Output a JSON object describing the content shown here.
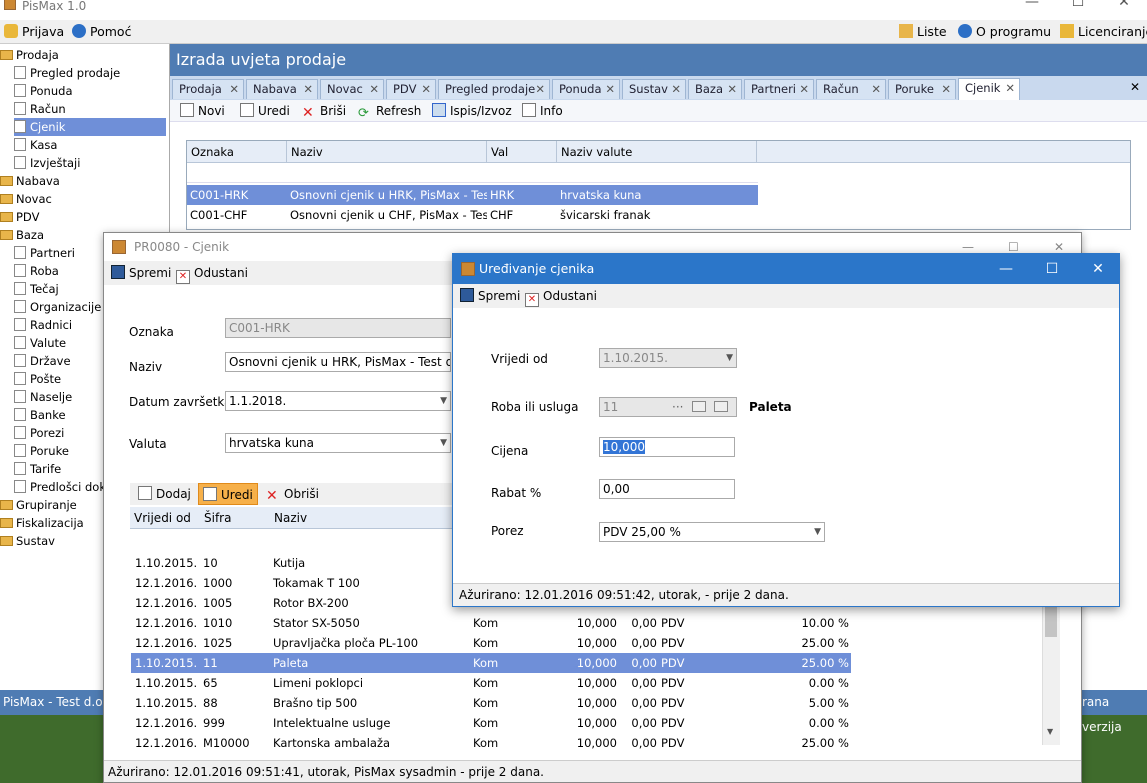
{
  "app": {
    "title": "PisMax 1.0"
  },
  "menu": {
    "left": [
      "Prijava",
      "Pomoć"
    ],
    "right": [
      "Liste",
      "O programu",
      "Licenciranje"
    ]
  },
  "sidebar": {
    "items": [
      {
        "label": "Prodaja",
        "level": 0,
        "type": "folder"
      },
      {
        "label": "Pregled prodaje",
        "level": 1
      },
      {
        "label": "Ponuda",
        "level": 1
      },
      {
        "label": "Račun",
        "level": 1
      },
      {
        "label": "Cjenik",
        "level": 1,
        "selected": true
      },
      {
        "label": "Kasa",
        "level": 1
      },
      {
        "label": "Izvještaji",
        "level": 1
      },
      {
        "label": "Nabava",
        "level": 0,
        "type": "folder"
      },
      {
        "label": "Novac",
        "level": 0,
        "type": "folder"
      },
      {
        "label": "PDV",
        "level": 0,
        "type": "folder"
      },
      {
        "label": "Baza",
        "level": 0,
        "type": "folder"
      },
      {
        "label": "Partneri",
        "level": 1
      },
      {
        "label": "Roba",
        "level": 1
      },
      {
        "label": "Tečaj",
        "level": 1
      },
      {
        "label": "Organizacije",
        "level": 1
      },
      {
        "label": "Radnici",
        "level": 1
      },
      {
        "label": "Valute",
        "level": 1
      },
      {
        "label": "Države",
        "level": 1
      },
      {
        "label": "Pošte",
        "level": 1
      },
      {
        "label": "Naselje",
        "level": 1
      },
      {
        "label": "Banke",
        "level": 1
      },
      {
        "label": "Porezi",
        "level": 1
      },
      {
        "label": "Poruke",
        "level": 1
      },
      {
        "label": "Tarife",
        "level": 1
      },
      {
        "label": "Predlošci dokum",
        "level": 1
      },
      {
        "label": "Grupiranje",
        "level": 0,
        "type": "folder"
      },
      {
        "label": "Fiskalizacija",
        "level": 0,
        "type": "folder"
      },
      {
        "label": "Sustav",
        "level": 0,
        "type": "folder"
      }
    ]
  },
  "header": {
    "title": "Izrada uvjeta prodaje"
  },
  "tabs": [
    "Prodaja",
    "Nabava",
    "Novac",
    "PDV",
    "Pregled prodaje",
    "Ponuda",
    "Sustav",
    "Baza",
    "Partneri",
    "Račun",
    "Poruke",
    "Cjenik"
  ],
  "toolbar": {
    "buttons": [
      "Novi",
      "Uredi",
      "Briši",
      "Refresh",
      "Ispis/Izvoz",
      "Info"
    ]
  },
  "grid1": {
    "headers": [
      "Oznaka",
      "Naziv",
      "Val",
      "Naziv valute"
    ],
    "rows": [
      [
        "C001-HRK",
        "Osnovni cjenik u HRK, PisMax - Test d...",
        "HRK",
        "hrvatska kuna"
      ],
      [
        "C001-CHF",
        "Osnovni cjenik u CHF, PisMax - Test d...",
        "CHF",
        "švicarski franak"
      ]
    ]
  },
  "status": {
    "left": "PisMax - Test d.o.o.",
    "right": "rana verzija"
  },
  "dialog1": {
    "title": "PR0080 - Cjenik",
    "save": "Spremi",
    "cancel": "Odustani",
    "labels": {
      "oznaka": "Oznaka",
      "naziv": "Naziv",
      "datum": "Datum završetka",
      "valuta": "Valuta"
    },
    "values": {
      "oznaka": "C001-HRK",
      "naziv": "Osnovni cjenik u HRK, PisMax - Test d.o.o.",
      "datum": "1.1.2018.",
      "valuta": "hrvatska kuna"
    },
    "subtoolbar": [
      "Dodaj",
      "Uredi",
      "Obriši"
    ],
    "headers": [
      "Vrijedi od",
      "Šifra",
      "Naziv"
    ],
    "rows": [
      [
        "1.10.2015.",
        "10",
        "Kutija",
        "",
        "",
        "",
        "",
        ""
      ],
      [
        "12.1.2016.",
        "1000",
        "Tokamak T 100",
        "",
        "",
        "",
        "",
        ""
      ],
      [
        "12.1.2016.",
        "1005",
        "Rotor BX-200",
        "",
        "",
        "",
        "",
        ""
      ],
      [
        "12.1.2016.",
        "1010",
        "Stator SX-5050",
        "Kom",
        "10,000",
        "0,00",
        "PDV",
        "10.00 %"
      ],
      [
        "12.1.2016.",
        "1025",
        "Upravljačka ploča PL-100",
        "Kom",
        "10,000",
        "0,00",
        "PDV",
        "25.00 %"
      ],
      [
        "1.10.2015.",
        "11",
        "Paleta",
        "Kom",
        "10,000",
        "0,00",
        "PDV",
        "25.00 %"
      ],
      [
        "1.10.2015.",
        "65",
        "Limeni poklopci",
        "Kom",
        "10,000",
        "0,00",
        "PDV",
        "0.00 %"
      ],
      [
        "1.10.2015.",
        "88",
        "Brašno tip 500",
        "Kom",
        "10,000",
        "0,00",
        "PDV",
        "5.00 %"
      ],
      [
        "12.1.2016.",
        "999",
        "Intelektualne usluge",
        "Kom",
        "10,000",
        "0,00",
        "PDV",
        "0.00 %"
      ],
      [
        "12.1.2016.",
        "M10000",
        "Kartonska ambalaža",
        "Kom",
        "10,000",
        "0,00",
        "PDV",
        "25.00 %"
      ]
    ],
    "status": "Ažurirano: 12.01.2016 09:51:41, utorak, PisMax sysadmin -  prije 2 dana."
  },
  "dialog2": {
    "title": "Uređivanje cjenika",
    "save": "Spremi",
    "cancel": "Odustani",
    "labels": {
      "vrijedi": "Vrijedi od",
      "roba": "Roba ili usluga",
      "cijena": "Cijena",
      "rabat": "Rabat %",
      "porez": "Porez"
    },
    "values": {
      "vrijedi": "1.10.2015.",
      "roba": "11",
      "roba_name": "Paleta",
      "cijena": "10,000",
      "rabat": "0,00",
      "porez": "PDV 25,00 %"
    },
    "status": "Ažurirano: 12.01.2016 09:51:42, utorak,  -  prije 2 dana."
  }
}
